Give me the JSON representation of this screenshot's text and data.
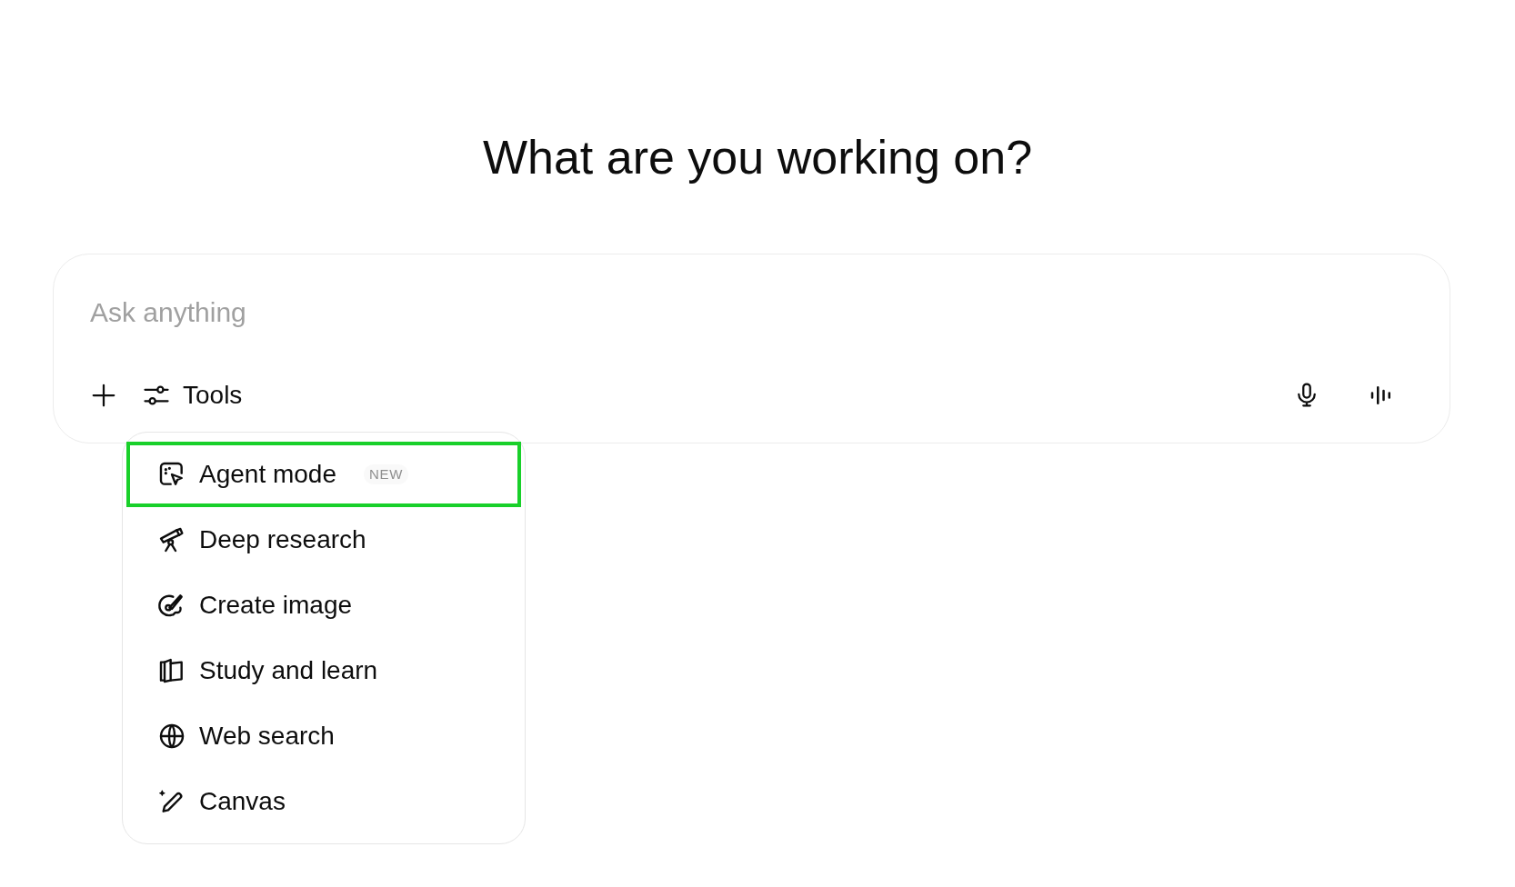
{
  "heading": "What are you working on?",
  "composer": {
    "placeholder": "Ask anything",
    "tools_label": "Tools"
  },
  "menu": {
    "items": [
      {
        "kind": "agent",
        "label": "Agent mode",
        "badge": "NEW",
        "selected": true
      },
      {
        "kind": "telescope",
        "label": "Deep research",
        "selected": false
      },
      {
        "kind": "palette",
        "label": "Create image",
        "selected": false
      },
      {
        "kind": "book",
        "label": "Study and learn",
        "selected": false
      },
      {
        "kind": "globe",
        "label": "Web search",
        "selected": false
      },
      {
        "kind": "pencil",
        "label": "Canvas",
        "selected": false
      }
    ]
  }
}
